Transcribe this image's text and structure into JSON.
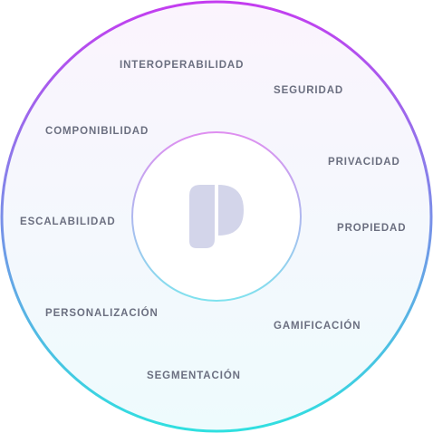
{
  "colors": {
    "outer_ring_top": "#c43cf0",
    "outer_ring_bottom": "#2fe0e0",
    "inner_ring_top": "#df8ef0",
    "inner_ring_bottom": "#7fe2ee",
    "fill_top": "#fbf4fd",
    "fill_bottom": "#eefbfd",
    "label": "#6b6f80",
    "logo": "#d3d5ea"
  },
  "logo": {
    "icon": "p-logo-icon"
  },
  "labels": {
    "interoperabilidad": "INTEROPERABILIDAD",
    "seguridad": "SEGURIDAD",
    "componibilidad": "COMPONIBILIDAD",
    "privacidad": "PRIVACIDAD",
    "escalabilidad": "ESCALABILIDAD",
    "propiedad": "PROPIEDAD",
    "personalizacion": "PERSONALIZACIÓN",
    "gamificacion": "GAMIFICACIÓN",
    "segmentacion": "SEGMENTACIÓN"
  }
}
